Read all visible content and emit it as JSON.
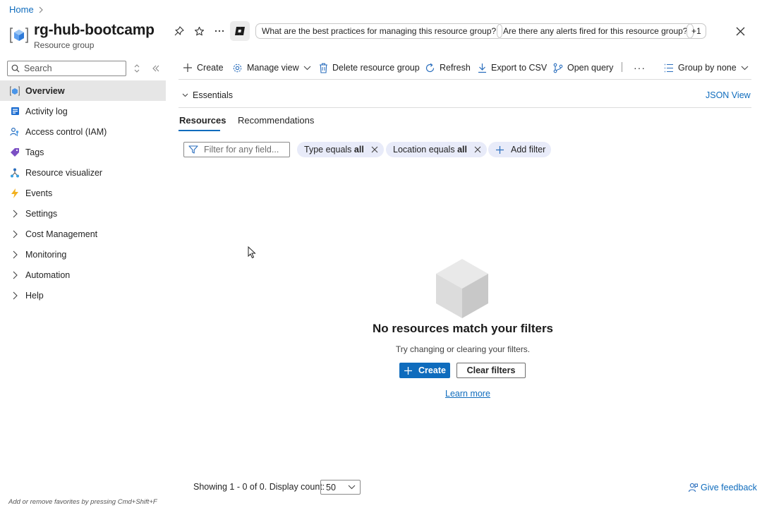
{
  "breadcrumb": {
    "home": "Home"
  },
  "header": {
    "title": "rg-hub-bootcamp",
    "subtitle": "Resource group",
    "suggestions": [
      "What are the best practices for managing this resource group?",
      "Are there any alerts fired for this resource group?",
      "+1"
    ]
  },
  "sidebar": {
    "search_placeholder": "Search",
    "items": [
      {
        "label": "Overview",
        "icon": "resource-group-icon",
        "active": true
      },
      {
        "label": "Activity log",
        "icon": "activity-log-icon"
      },
      {
        "label": "Access control (IAM)",
        "icon": "iam-icon"
      },
      {
        "label": "Tags",
        "icon": "tag-icon"
      },
      {
        "label": "Resource visualizer",
        "icon": "visualizer-icon"
      },
      {
        "label": "Events",
        "icon": "lightning-icon"
      },
      {
        "label": "Settings",
        "icon": "chevron-right-icon"
      },
      {
        "label": "Cost Management",
        "icon": "chevron-right-icon"
      },
      {
        "label": "Monitoring",
        "icon": "chevron-right-icon"
      },
      {
        "label": "Automation",
        "icon": "chevron-right-icon"
      },
      {
        "label": "Help",
        "icon": "chevron-right-icon"
      }
    ],
    "favorites_hint": "Add or remove favorites by pressing Cmd+Shift+F"
  },
  "toolbar": {
    "create": "Create",
    "manage_view": "Manage view",
    "delete": "Delete resource group",
    "refresh": "Refresh",
    "export": "Export to CSV",
    "open_query": "Open query",
    "more": "···",
    "group_by": "Group by none"
  },
  "essentials": {
    "label": "Essentials",
    "json_view": "JSON View"
  },
  "tabs": [
    {
      "label": "Resources",
      "active": true
    },
    {
      "label": "Recommendations"
    }
  ],
  "filters": {
    "placeholder": "Filter for any field...",
    "pills": [
      {
        "field": "Type",
        "op": "equals",
        "value": "all"
      },
      {
        "field": "Location",
        "op": "equals",
        "value": "all"
      }
    ],
    "add_filter": "Add filter"
  },
  "empty_state": {
    "title": "No resources match your filters",
    "subtitle": "Try changing or clearing your filters.",
    "create": "Create",
    "clear": "Clear filters",
    "learn_more": "Learn more"
  },
  "footer": {
    "showing": "Showing 1 - 0 of 0. Display count:",
    "display_count": "50",
    "feedback": "Give feedback"
  },
  "colors": {
    "accent": "#0f6cbd",
    "pill_bg": "#e8ebf9",
    "active_nav_bg": "#e6e6e6"
  }
}
